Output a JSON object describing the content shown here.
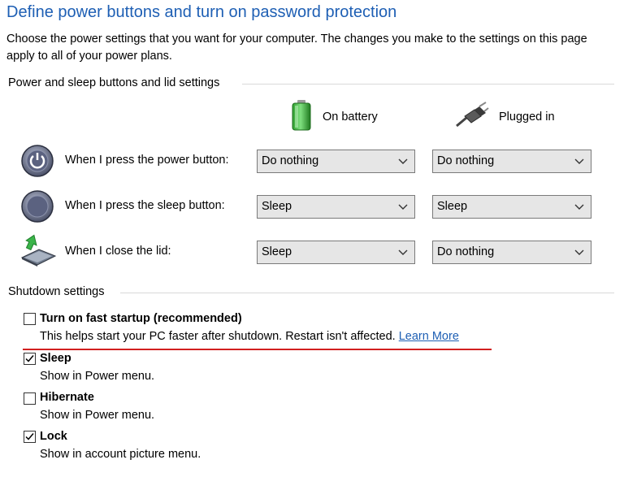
{
  "title": "Define power buttons and turn on password protection",
  "description": "Choose the power settings that you want for your computer. The changes you make to the settings on this page apply to all of your power plans.",
  "power_section": {
    "header": "Power and sleep buttons and lid settings",
    "columns": [
      {
        "label": "On battery",
        "icon": "battery-icon"
      },
      {
        "label": "Plugged in",
        "icon": "power-plug-icon"
      }
    ],
    "rows": [
      {
        "label": "When I press the power button:",
        "icon": "power-button-icon",
        "on_battery": "Do nothing",
        "plugged_in": "Do nothing"
      },
      {
        "label": "When I press the sleep button:",
        "icon": "sleep-button-icon",
        "on_battery": "Sleep",
        "plugged_in": "Sleep"
      },
      {
        "label": "When I close the lid:",
        "icon": "laptop-lid-icon",
        "on_battery": "Sleep",
        "plugged_in": "Do nothing"
      }
    ]
  },
  "shutdown_section": {
    "header": "Shutdown settings",
    "options": [
      {
        "label": "Turn on fast startup (recommended)",
        "checked": false,
        "description": "This helps start your PC faster after shutdown. Restart isn't affected.",
        "link": "Learn More"
      },
      {
        "label": "Sleep",
        "checked": true,
        "description": "Show in Power menu."
      },
      {
        "label": "Hibernate",
        "checked": false,
        "description": "Show in Power menu."
      },
      {
        "label": "Lock",
        "checked": true,
        "description": "Show in account picture menu."
      }
    ]
  },
  "colors": {
    "title": "#1e5fb4",
    "link": "#1e5fb4",
    "annotation_underline": "#d22020",
    "dropdown_bg": "#e6e6e6"
  }
}
